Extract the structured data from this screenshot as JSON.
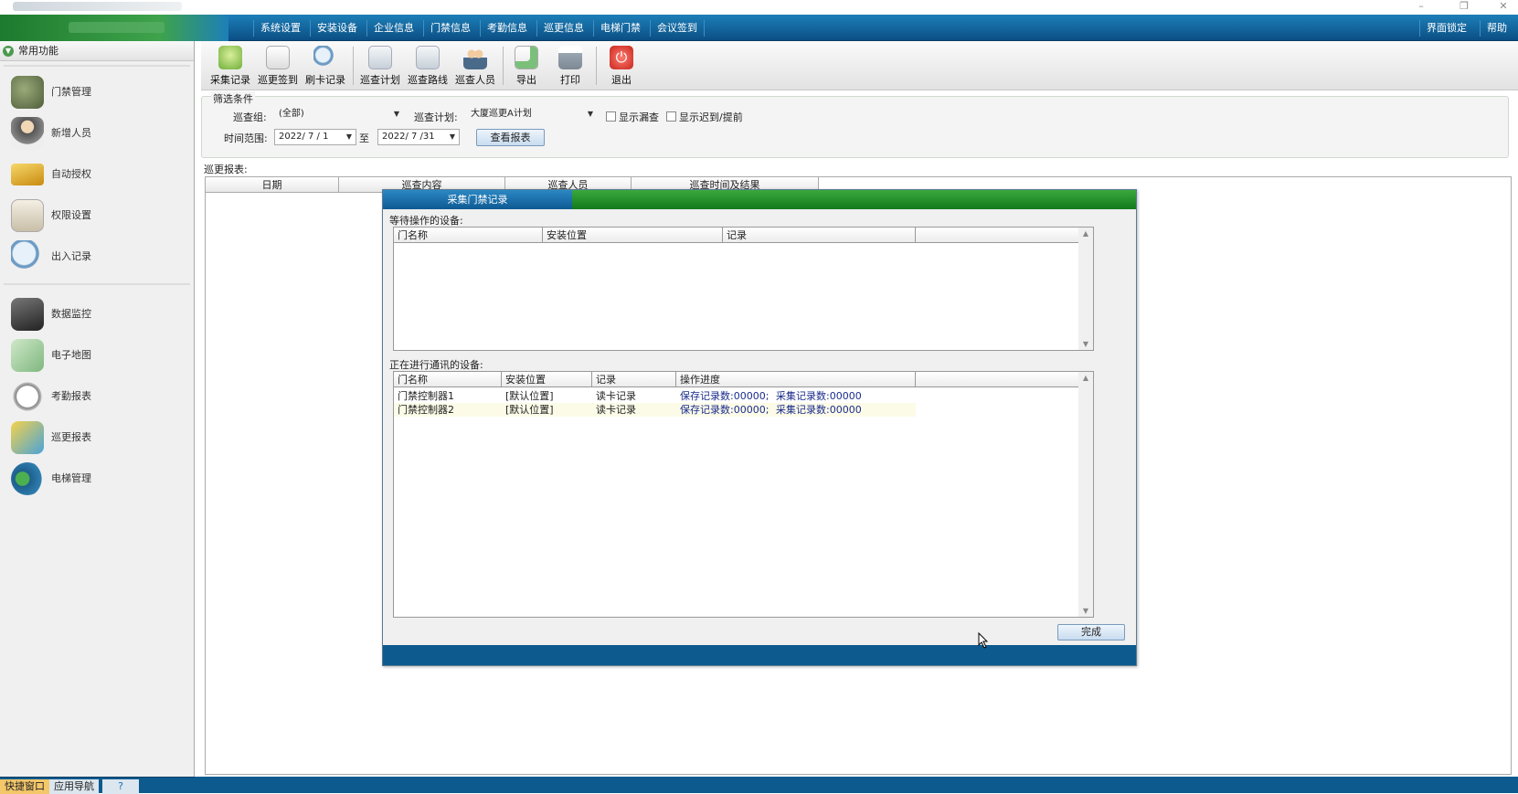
{
  "menubar": {
    "items": [
      "系统设置",
      "安装设备",
      "企业信息",
      "门禁信息",
      "考勤信息",
      "巡更信息",
      "电梯门禁",
      "会议签到"
    ],
    "right_items": [
      "界面锁定",
      "帮助"
    ]
  },
  "window_controls": {
    "minimize": "–",
    "restore": "❐",
    "close": "✕"
  },
  "sidebar": {
    "header": "常用功能",
    "items": [
      {
        "label": "门禁管理",
        "icon": "access-control-icon",
        "color": "#6b7a5a"
      },
      {
        "label": "新增人员",
        "icon": "person-icon",
        "color": "#8a8fa0"
      },
      {
        "label": "自动授权",
        "icon": "card-icon",
        "color": "#d9a52a"
      },
      {
        "label": "权限设置",
        "icon": "permission-icon",
        "color": "#b8b0a0"
      },
      {
        "label": "出入记录",
        "icon": "magnifier-icon",
        "color": "#7fa7c8"
      },
      {
        "label": "数据监控",
        "icon": "camera-icon",
        "color": "#4a4a4a"
      },
      {
        "label": "电子地图",
        "icon": "map-icon",
        "color": "#8cbf8c"
      },
      {
        "label": "考勤报表",
        "icon": "clock-icon",
        "color": "#a0a0a0"
      },
      {
        "label": "巡更报表",
        "icon": "patrol-icon",
        "color": "#e0b83a"
      },
      {
        "label": "电梯管理",
        "icon": "elevator-icon",
        "color": "#2f7fb0"
      }
    ]
  },
  "bottom_tabs": [
    "快捷窗口",
    "应用导航",
    "?"
  ],
  "toolbar": {
    "buttons": [
      {
        "label": "采集记录",
        "icon": "collect-icon",
        "color": "#6fae3a"
      },
      {
        "label": "巡更签到",
        "icon": "checkin-icon",
        "color": "#5cb85c"
      },
      {
        "label": "刷卡记录",
        "icon": "search-records-icon",
        "color": "#7aa6cc"
      },
      {
        "label": "巡查计划",
        "icon": "plan-icon",
        "color": "#cfd8e0"
      },
      {
        "label": "巡查路线",
        "icon": "route-icon",
        "color": "#cfd8e0"
      },
      {
        "label": "巡查人员",
        "icon": "people-icon",
        "color": "#4a6a8a"
      },
      {
        "label": "导出",
        "icon": "export-icon",
        "color": "#7ac07a"
      },
      {
        "label": "打印",
        "icon": "print-icon",
        "color": "#9aa6b0"
      },
      {
        "label": "退出",
        "icon": "exit-icon",
        "color": "#d9342b"
      }
    ]
  },
  "filter": {
    "legend": "筛选条件",
    "group_label": "巡查组:",
    "group_value": "(全部)",
    "plan_label": "巡查计划:",
    "plan_value": "大厦巡更A计划",
    "show_missed": "显示漏查",
    "show_late": "显示迟到/提前",
    "time_label": "时间范围:",
    "date_from": "2022/ 7 / 1",
    "to": "至",
    "date_to": "2022/ 7 /31",
    "query_button": "查看报表"
  },
  "report": {
    "label": "巡更报表:",
    "columns": [
      "日期",
      "巡查内容",
      "巡查人员",
      "巡查时间及结果"
    ]
  },
  "dialog": {
    "title": "采集门禁记录",
    "waiting_label": "等待操作的设备:",
    "waiting_columns": [
      "门名称",
      "安装位置",
      "记录"
    ],
    "active_label": "正在进行通讯的设备:",
    "active_columns": [
      "门名称",
      "安装位置",
      "记录",
      "操作进度"
    ],
    "active_rows": [
      {
        "door": "门禁控制器1",
        "location": "[默认位置]",
        "record": "读卡记录",
        "progress_a": "保存记录数:00000;",
        "progress_b": "采集记录数:00000"
      },
      {
        "door": "门禁控制器2",
        "location": "[默认位置]",
        "record": "读卡记录",
        "progress_a": "保存记录数:00000;",
        "progress_b": "采集记录数:00000"
      }
    ],
    "done_button": "完成"
  }
}
